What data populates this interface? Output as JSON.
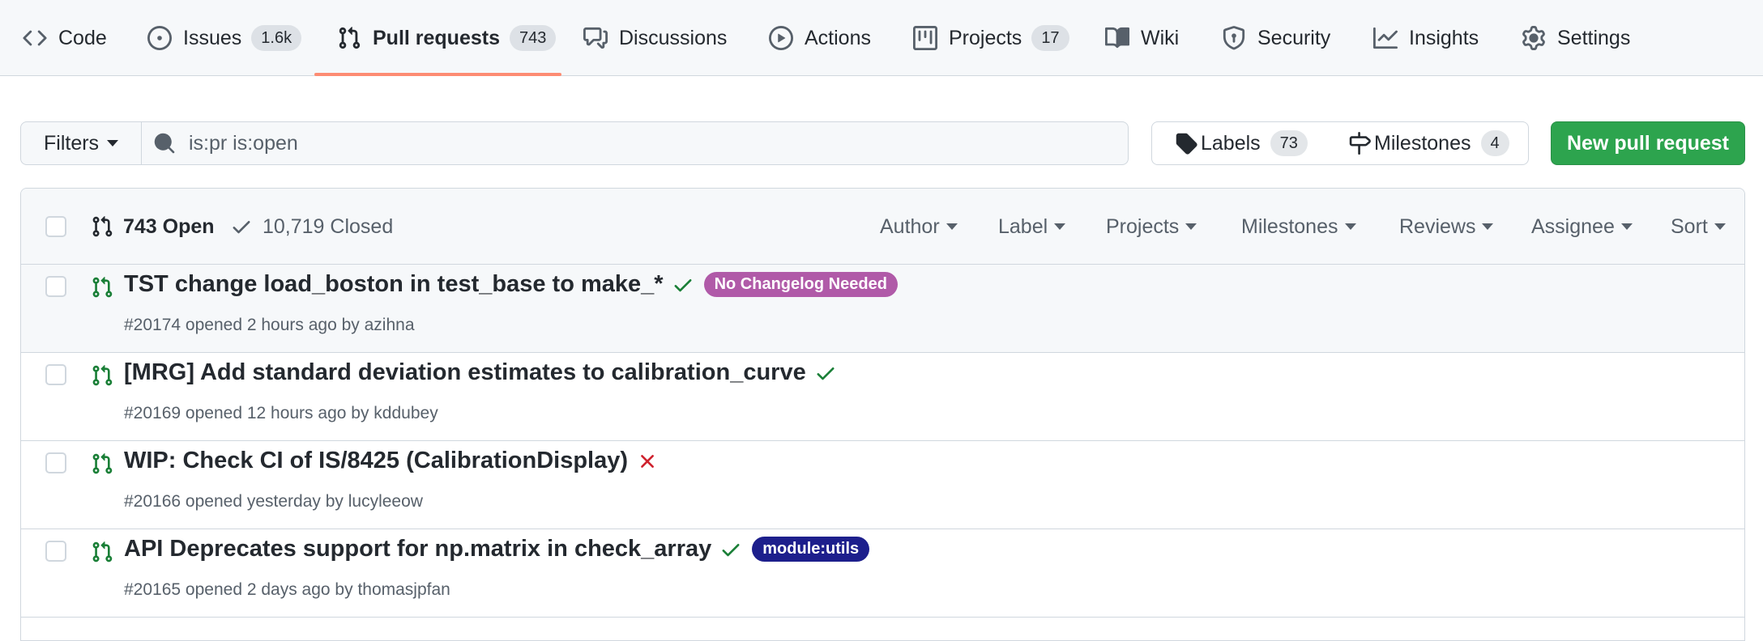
{
  "tabs": [
    {
      "label": "Code",
      "icon": "code-icon"
    },
    {
      "label": "Issues",
      "count": "1.6k",
      "icon": "issue-opened-icon"
    },
    {
      "label": "Pull requests",
      "count": "743",
      "icon": "git-pull-request-icon",
      "selected": true
    },
    {
      "label": "Discussions",
      "icon": "comment-discussion-icon"
    },
    {
      "label": "Actions",
      "icon": "play-icon"
    },
    {
      "label": "Projects",
      "count": "17",
      "icon": "project-icon"
    },
    {
      "label": "Wiki",
      "icon": "book-icon"
    },
    {
      "label": "Security",
      "icon": "shield-icon"
    },
    {
      "label": "Insights",
      "icon": "graph-icon"
    },
    {
      "label": "Settings",
      "icon": "gear-icon"
    }
  ],
  "toolbar": {
    "filters_label": "Filters",
    "search_value": "is:pr is:open",
    "labels_label": "Labels",
    "labels_count": "73",
    "milestones_label": "Milestones",
    "milestones_count": "4",
    "new_pr_label": "New pull request"
  },
  "list_header": {
    "open_label": "743 Open",
    "closed_label": "10,719 Closed",
    "filters": [
      "Author",
      "Label",
      "Projects",
      "Milestones",
      "Reviews",
      "Assignee",
      "Sort"
    ]
  },
  "pull_requests": [
    {
      "title": "TST change load_boston in test_base to make_*",
      "status": "success",
      "label": {
        "text": "No Changelog Needed",
        "color": "#b05aa8"
      },
      "number": "#20174",
      "opened": "opened 2 hours ago by",
      "author": "azihna"
    },
    {
      "title": "[MRG] Add standard deviation estimates to calibration_curve",
      "status": "success",
      "number": "#20169",
      "opened": "opened 12 hours ago by",
      "author": "kddubey"
    },
    {
      "title": "WIP: Check CI of IS/8425 (CalibrationDisplay)",
      "status": "failure",
      "number": "#20166",
      "opened": "opened yesterday by",
      "author": "lucyleeow"
    },
    {
      "title": "API Deprecates support for np.matrix in check_array",
      "status": "success",
      "label": {
        "text": "module:utils",
        "color": "#1d1f8c"
      },
      "number": "#20165",
      "opened": "opened 2 days ago by",
      "author": "thomasjpfan"
    }
  ],
  "colors": {
    "accent_underline": "#fd8c73",
    "primary_button": "#2da44e",
    "open_icon": "#1a7f37",
    "success_check": "#1a7f37",
    "failure_x": "#cf222e"
  }
}
